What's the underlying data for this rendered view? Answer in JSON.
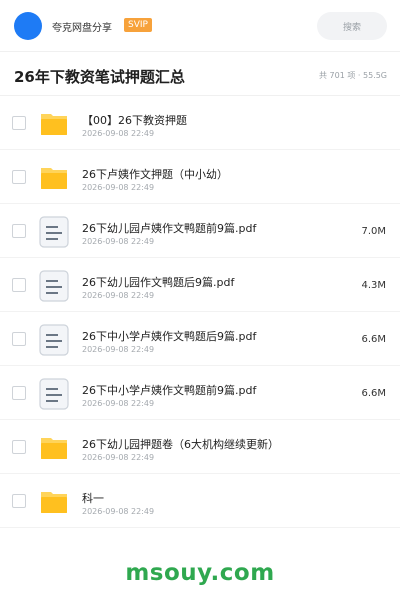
{
  "header": {
    "brand": "夸克网盘分享",
    "badge": "SVIP",
    "search_placeholder": "搜索"
  },
  "page": {
    "title": "26年下教资笔试押题汇总",
    "meta": "共 701 项 · 55.5G"
  },
  "files": [
    {
      "type": "folder",
      "name": "【00】26下教资押题",
      "date": "2026-09-08 22:49",
      "size": ""
    },
    {
      "type": "folder",
      "name": "26下卢姨作文押题（中小幼）",
      "date": "2026-09-08 22:49",
      "size": ""
    },
    {
      "type": "doc",
      "name": "26下幼儿园卢姨作文鸭题前9篇.pdf",
      "date": "2026-09-08 22:49",
      "size": "7.0M"
    },
    {
      "type": "doc",
      "name": "26下幼儿园作文鸭题后9篇.pdf",
      "date": "2026-09-08 22:49",
      "size": "4.3M"
    },
    {
      "type": "doc",
      "name": "26下中小学卢姨作文鸭题后9篇.pdf",
      "date": "2026-09-08 22:49",
      "size": "6.6M"
    },
    {
      "type": "doc",
      "name": "26下中小学卢姨作文鸭题前9篇.pdf",
      "date": "2026-09-08 22:49",
      "size": "6.6M"
    },
    {
      "type": "folder",
      "name": "26下幼儿园押题卷（6大机构继续更新）",
      "date": "2026-09-08 22:49",
      "size": ""
    },
    {
      "type": "folder",
      "name": "科一",
      "date": "2026-09-08 22:49",
      "size": ""
    }
  ],
  "watermark": "msouy.com",
  "colors": {
    "accent": "#1e7bf5",
    "badge": "#f7a23b",
    "folder": "#ffc01f",
    "watermark": "#2fa84f"
  }
}
